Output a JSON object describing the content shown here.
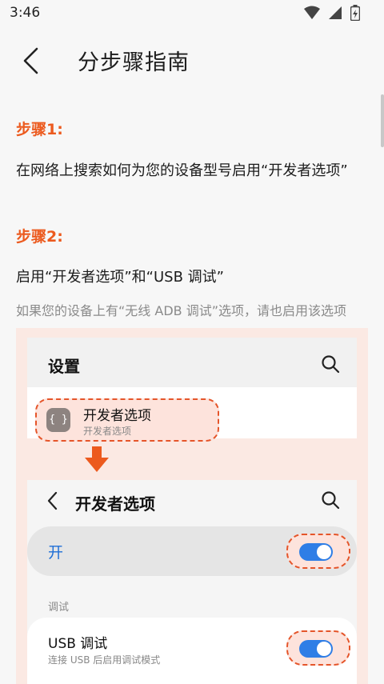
{
  "status": {
    "time": "3:46"
  },
  "header": {
    "title": "分步骤指南"
  },
  "steps": [
    {
      "title": "步骤1:",
      "text": "在网络上搜索如何为您的设备型号启用“开发者选项”"
    },
    {
      "title": "步骤2:",
      "text": "启用“开发者选项”和“USB 调试”",
      "hint": "如果您的设备上有“无线 ADB 调试”选项，请也启用该选项"
    }
  ],
  "illustration": {
    "settings_title": "设置",
    "dev_option_label": "开发者选项",
    "dev_option_sub": "开发者选项",
    "dev_option_icon": "{ }",
    "dev_page_title": "开发者选项",
    "on_label": "开",
    "section_label": "调试",
    "usb_label": "USB 调试",
    "usb_sub": "连接 USB 后启用调试模式"
  },
  "colors": {
    "accent": "#ec5a1e",
    "toggle": "#2f7ee6",
    "highlight_border": "#e5552a",
    "illustration_bg": "#fbe9e3"
  }
}
